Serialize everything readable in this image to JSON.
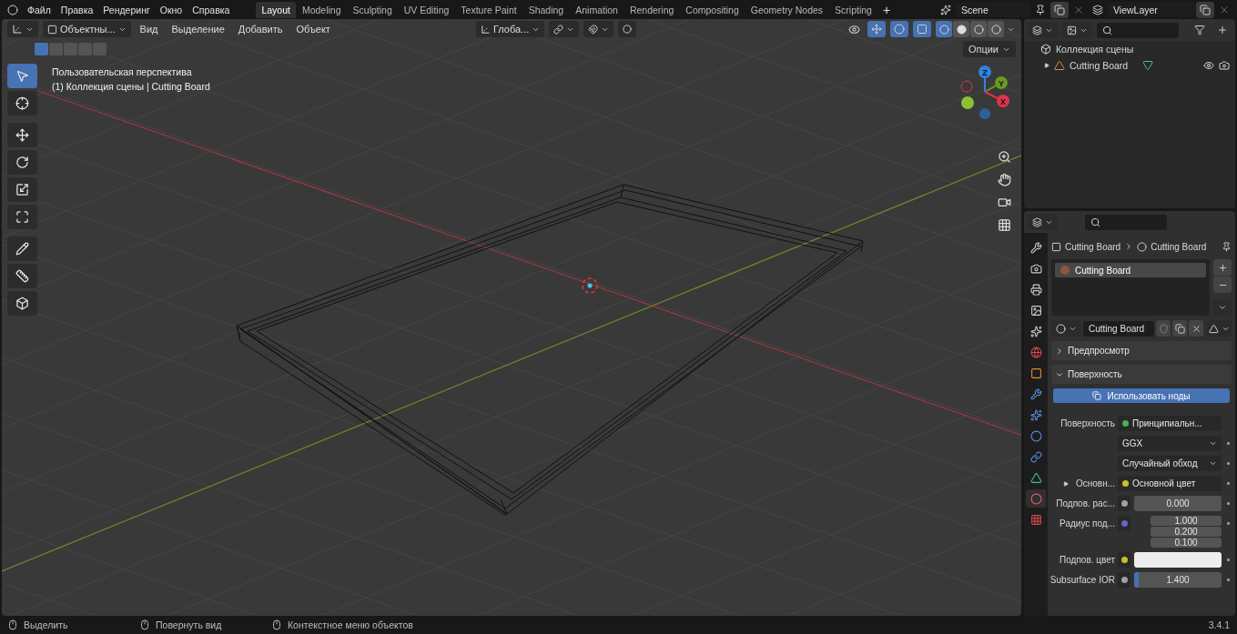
{
  "menu": [
    "Файл",
    "Правка",
    "Рендеринг",
    "Окно",
    "Справка"
  ],
  "workspaces": [
    {
      "label": "Layout",
      "selected": true
    },
    {
      "label": "Modeling",
      "selected": false
    },
    {
      "label": "Sculpting",
      "selected": false
    },
    {
      "label": "UV Editing",
      "selected": false
    },
    {
      "label": "Texture Paint",
      "selected": false
    },
    {
      "label": "Shading",
      "selected": false
    },
    {
      "label": "Animation",
      "selected": false
    },
    {
      "label": "Rendering",
      "selected": false
    },
    {
      "label": "Compositing",
      "selected": false
    },
    {
      "label": "Geometry Nodes",
      "selected": false
    },
    {
      "label": "Scripting",
      "selected": false
    }
  ],
  "add_workspace": "+",
  "scene": "Scene",
  "view_layer": "ViewLayer",
  "viewport": {
    "mode": "Объектны...",
    "menus": [
      "Вид",
      "Выделение",
      "Добавить",
      "Объект"
    ],
    "orientation": "Глоба...",
    "options": "Опции",
    "shading": [
      {
        "selected": true
      },
      {
        "selected": false
      },
      {
        "selected": false
      },
      {
        "selected": false
      }
    ],
    "select_modes": [
      {
        "selected": true
      },
      {
        "selected": false
      },
      {
        "selected": false
      },
      {
        "selected": false
      },
      {
        "selected": false
      }
    ],
    "overlay_text": [
      "Пользовательская перспектива",
      "(1) Коллекция сцены | Cutting Board"
    ],
    "tools": [
      {
        "kind": "select",
        "selected": true
      },
      {
        "kind": "cursor",
        "selected": false
      },
      {
        "kind": "move",
        "selected": false
      },
      {
        "kind": "rotate",
        "selected": false
      },
      {
        "kind": "scale",
        "selected": false
      },
      {
        "kind": "transform",
        "selected": false
      },
      {
        "kind": "annotate",
        "selected": false
      },
      {
        "kind": "measure",
        "selected": false
      },
      {
        "kind": "add-cube",
        "selected": false
      }
    ],
    "axes": [
      {
        "label": "Z",
        "color": "#2f83e3"
      },
      {
        "label": "Y",
        "color": "#6a9a1f"
      },
      {
        "label": "X",
        "color": "#e0334c"
      }
    ]
  },
  "outliner": {
    "collection": "Коллекция сцены",
    "items": [
      {
        "label": "Cutting Board",
        "expanded": false
      }
    ]
  },
  "properties": {
    "tabs": [
      {
        "kind": "tool",
        "selected": false
      },
      {
        "kind": "render",
        "selected": false
      },
      {
        "kind": "output",
        "selected": false
      },
      {
        "kind": "view",
        "selected": false
      },
      {
        "kind": "scene",
        "selected": false
      },
      {
        "kind": "world",
        "selected": false
      },
      {
        "kind": "object",
        "selected": false
      },
      {
        "kind": "modifier",
        "selected": false
      },
      {
        "kind": "particles",
        "selected": false
      },
      {
        "kind": "physics",
        "selected": false
      },
      {
        "kind": "constraints",
        "selected": false
      },
      {
        "kind": "data",
        "selected": false
      },
      {
        "kind": "material",
        "selected": true
      },
      {
        "kind": "texture",
        "selected": false
      }
    ],
    "breadcrumb": [
      "Cutting Board",
      "Cutting Board"
    ],
    "slots": [
      {
        "label": "Cutting Board",
        "selected": true
      }
    ],
    "material_name": "Cutting Board",
    "panels": [
      {
        "title": "Предпросмотр",
        "expanded": false
      },
      {
        "title": "Поверхность",
        "expanded": true
      }
    ],
    "use_nodes": "Использовать ноды",
    "rows": [
      {
        "kind": "socket",
        "label": "Поверхность",
        "value": "Принципиальн...",
        "color": "#4caf50"
      },
      {
        "kind": "dropdown",
        "value": "GGX"
      },
      {
        "kind": "dropdown",
        "value": "Случайный обход"
      },
      {
        "kind": "socket",
        "label": "Основн...",
        "value": "Основной цвет",
        "color": "#c7c229"
      },
      {
        "kind": "number",
        "label": "Подпов. рас...",
        "values": [
          "0.000"
        ],
        "color": "#a0a0a0"
      },
      {
        "kind": "number",
        "label": "Радиус под...",
        "values": [
          "1.000",
          "0.200",
          "0.100"
        ],
        "color": "#6363c7"
      },
      {
        "kind": "swatch",
        "label": "Подпов. цвет",
        "color": "#c7c229"
      },
      {
        "kind": "slider",
        "label": "Subsurface IOR",
        "value": "1.400",
        "color": "#a0a0a0",
        "level": 0.05
      }
    ]
  },
  "status": [
    "Выделить",
    "Повернуть вид",
    "Контекстное меню объектов"
  ],
  "version": "3.4.1"
}
